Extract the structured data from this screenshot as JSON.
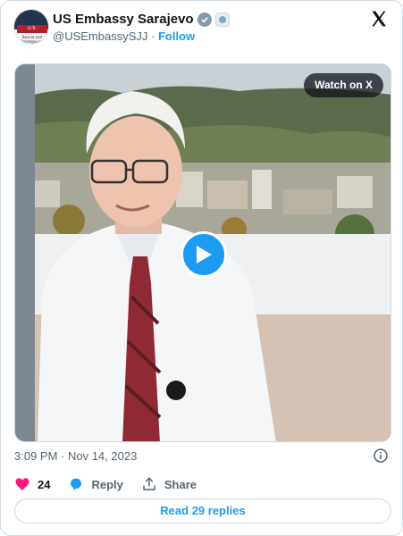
{
  "account": {
    "name": "US Embassy Sarajevo",
    "handle": "@USEmbassySJJ",
    "separator": "·",
    "follow_label": "Follow",
    "avatar_banner": "U.S. EMBASSY",
    "avatar_sub": "Bosnia and Herzegovina"
  },
  "media": {
    "watch_label": "Watch on X"
  },
  "post": {
    "timestamp": "3:09 PM · Nov 14, 2023"
  },
  "actions": {
    "likes": "24",
    "reply_label": "Reply",
    "share_label": "Share"
  },
  "read_replies_label": "Read 29 replies",
  "colors": {
    "accent": "#1d9bf0",
    "like": "#f91880",
    "muted_text": "#536471"
  },
  "icons": [
    "verified-badge-icon",
    "affiliate-badge-icon",
    "x-logo-icon",
    "play-icon",
    "info-icon",
    "heart-icon",
    "reply-bubble-icon",
    "share-icon"
  ]
}
